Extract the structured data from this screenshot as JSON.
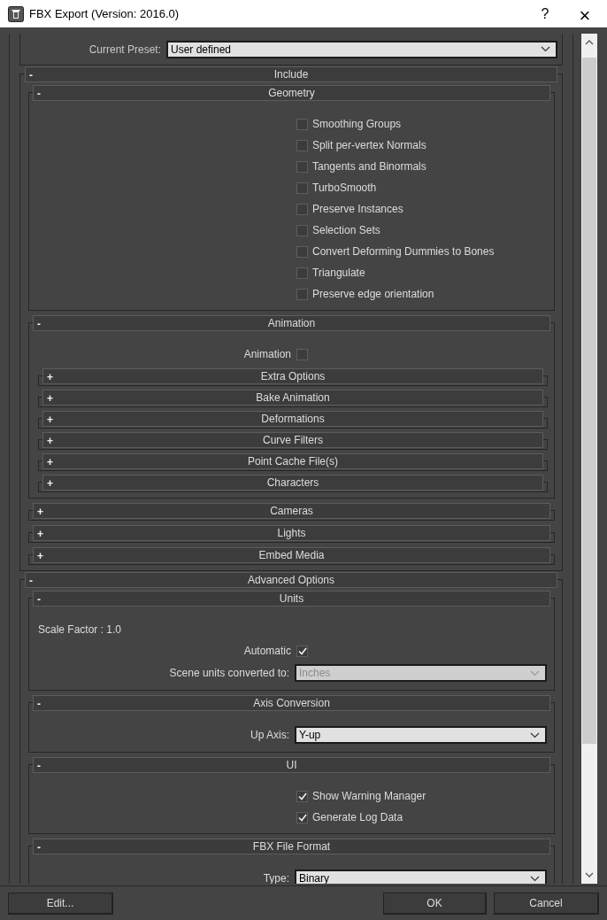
{
  "window": {
    "title": "FBX Export (Version: 2016.0)",
    "help": "?",
    "close": "×"
  },
  "preset": {
    "label": "Current Preset:",
    "value": "User defined"
  },
  "sections": [
    {
      "toggle": "-",
      "title": "Include",
      "expanded": true,
      "items": [
        {
          "kind": "section",
          "toggle": "-",
          "title": "Geometry",
          "expanded": true,
          "items": [
            {
              "kind": "checkbox",
              "label": "Smoothing Groups",
              "checked": false
            },
            {
              "kind": "checkbox",
              "label": "Split per-vertex Normals",
              "checked": false
            },
            {
              "kind": "checkbox",
              "label": "Tangents and Binormals",
              "checked": false
            },
            {
              "kind": "checkbox",
              "label": "TurboSmooth",
              "checked": false
            },
            {
              "kind": "checkbox",
              "label": "Preserve Instances",
              "checked": false
            },
            {
              "kind": "checkbox",
              "label": "Selection Sets",
              "checked": false
            },
            {
              "kind": "checkbox",
              "label": "Convert Deforming Dummies to Bones",
              "checked": false
            },
            {
              "kind": "checkbox",
              "label": "Triangulate",
              "checked": false
            },
            {
              "kind": "checkbox",
              "label": "Preserve edge orientation",
              "checked": false
            }
          ]
        },
        {
          "kind": "section",
          "toggle": "-",
          "title": "Animation",
          "expanded": true,
          "items": [
            {
              "kind": "labeled_checkbox",
              "label": "Animation",
              "checked": false
            },
            {
              "kind": "section",
              "toggle": "+",
              "title": "Extra Options",
              "expanded": false
            },
            {
              "kind": "section",
              "toggle": "+",
              "title": "Bake Animation",
              "expanded": false
            },
            {
              "kind": "section",
              "toggle": "+",
              "title": "Deformations",
              "expanded": false
            },
            {
              "kind": "section",
              "toggle": "+",
              "title": "Curve Filters",
              "expanded": false
            },
            {
              "kind": "section",
              "toggle": "+",
              "title": "Point Cache File(s)",
              "expanded": false
            },
            {
              "kind": "section",
              "toggle": "+",
              "title": "Characters",
              "expanded": false
            }
          ]
        },
        {
          "kind": "section",
          "toggle": "+",
          "title": "Cameras",
          "expanded": false
        },
        {
          "kind": "section",
          "toggle": "+",
          "title": "Lights",
          "expanded": false
        },
        {
          "kind": "section",
          "toggle": "+",
          "title": "Embed Media",
          "expanded": false
        }
      ]
    },
    {
      "toggle": "-",
      "title": "Advanced Options",
      "expanded": true,
      "items": [
        {
          "kind": "section",
          "toggle": "-",
          "title": "Units",
          "expanded": true,
          "items": [
            {
              "kind": "text",
              "label": "Scale Factor : 1.0"
            },
            {
              "kind": "labeled_checkbox",
              "label": "Automatic",
              "checked": true
            },
            {
              "kind": "dropdown",
              "label": "Scene units converted to:",
              "value": "Inches",
              "disabled": true
            }
          ]
        },
        {
          "kind": "section",
          "toggle": "-",
          "title": "Axis Conversion",
          "expanded": true,
          "items": [
            {
              "kind": "dropdown",
              "label": "Up Axis:",
              "value": "Y-up",
              "disabled": false
            }
          ]
        },
        {
          "kind": "section",
          "toggle": "-",
          "title": "UI",
          "expanded": true,
          "items": [
            {
              "kind": "checkbox",
              "label": "Show Warning Manager",
              "checked": true
            },
            {
              "kind": "checkbox",
              "label": "Generate Log Data",
              "checked": true
            }
          ]
        },
        {
          "kind": "section",
          "toggle": "-",
          "title": "FBX File Format",
          "expanded": true,
          "items": [
            {
              "kind": "dropdown",
              "label": "Type:",
              "value": "Binary",
              "disabled": false
            }
          ]
        }
      ]
    }
  ],
  "footer": {
    "edit": "Edit...",
    "ok": "OK",
    "cancel": "Cancel"
  }
}
